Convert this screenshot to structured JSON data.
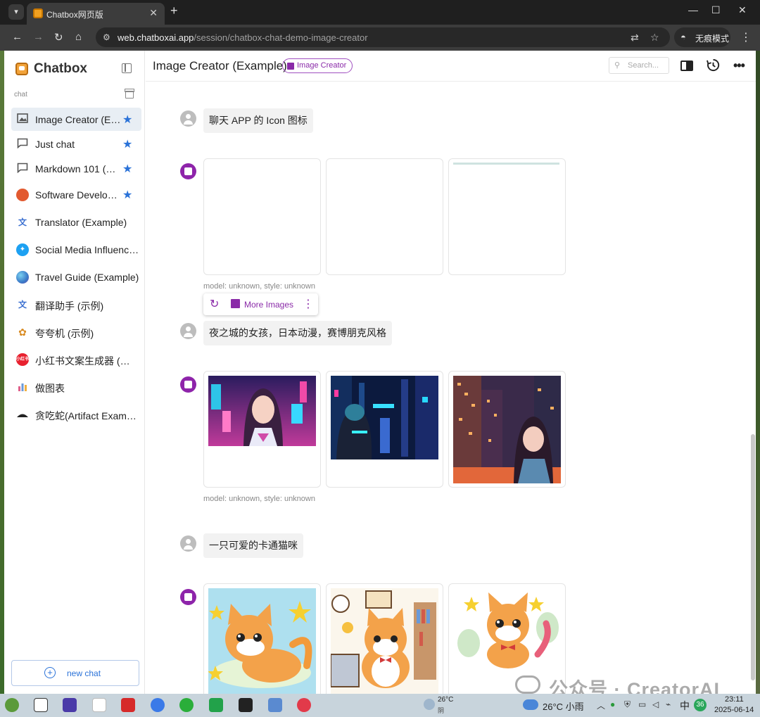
{
  "browser": {
    "tab_title": "Chatbox网页版",
    "url_host": "web.chatboxai.app",
    "url_path": "/session/chatbox-chat-demo-image-creator",
    "incognito_label": "无痕模式"
  },
  "sidebar": {
    "brand": "Chatbox",
    "section_label": "chat",
    "items": [
      {
        "label": "Image Creator (Example)",
        "icon": "image-icon",
        "starred": true,
        "active": true
      },
      {
        "label": "Just chat",
        "icon": "chat-bubble-icon",
        "starred": true
      },
      {
        "label": "Markdown 101 (Example)",
        "icon": "chat-bubble-icon",
        "starred": true
      },
      {
        "label": "Software Developer (Example)",
        "icon": "developer-avatar-icon",
        "starred": true
      },
      {
        "label": "Translator (Example)",
        "icon": "translate-icon",
        "starred": false
      },
      {
        "label": "Social Media Influencer (Example)",
        "icon": "twitter-icon",
        "starred": false
      },
      {
        "label": "Travel Guide (Example)",
        "icon": "globe-icon",
        "starred": false
      },
      {
        "label": "翻译助手 (示例)",
        "icon": "translate-icon",
        "starred": false
      },
      {
        "label": "夸夸机 (示例)",
        "icon": "flower-icon",
        "starred": false
      },
      {
        "label": "小红书文案生成器 (示例)",
        "icon": "xiaohongshu-icon",
        "starred": false
      },
      {
        "label": "做图表",
        "icon": "chart-icon",
        "starred": false
      },
      {
        "label": "贪吃蛇(Artifact Example)",
        "icon": "snake-icon",
        "starred": false
      }
    ],
    "new_chat_label": "new chat"
  },
  "header": {
    "title": "Image Creator (Example)",
    "badge": "Image Creator",
    "search_placeholder": "Search..."
  },
  "messages": [
    {
      "role": "user",
      "text": "聊天 APP 的 Icon 图标"
    },
    {
      "role": "assistant",
      "meta": "model: unknown, style: unknown",
      "toolbar": {
        "more_label": "More Images"
      }
    },
    {
      "role": "user",
      "text": "夜之城的女孩，日本动漫，赛博朋克风格"
    },
    {
      "role": "assistant",
      "meta": "model: unknown, style: unknown"
    },
    {
      "role": "user",
      "text": "一只可爱的卡通猫咪"
    },
    {
      "role": "assistant"
    }
  ],
  "watermark": "公众号 · CreatorAI",
  "taskbar": {
    "weather_temp": "26°C",
    "weather_cond": "阴",
    "tray_temp": "26°C 小雨",
    "ime": "中",
    "badge": "36",
    "time": "23:11",
    "date": "2025-06-14"
  },
  "colors": {
    "accent_blue": "#2a72d8",
    "accent_purple": "#8a2aa8",
    "active_item_bg": "#e8eef4"
  }
}
